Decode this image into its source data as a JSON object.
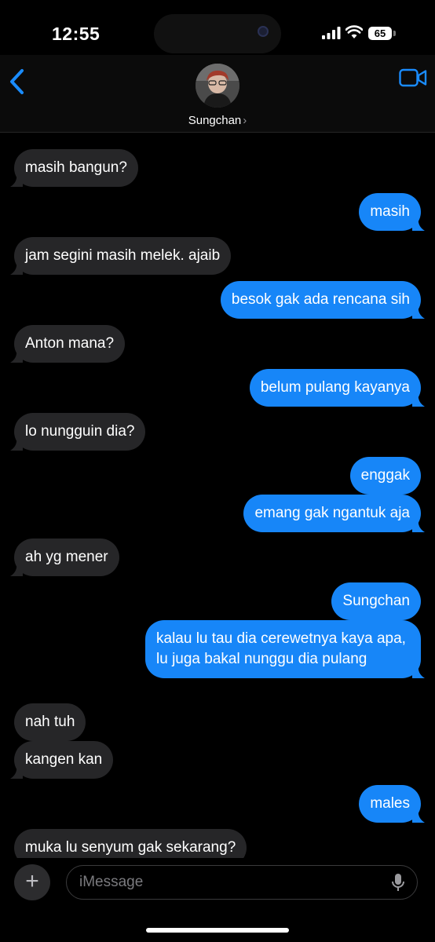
{
  "status": {
    "time": "12:55",
    "battery": "65"
  },
  "header": {
    "contact_name": "Sungchan",
    "chevron": "›"
  },
  "messages": [
    {
      "dir": "in",
      "text": "masih bangun?"
    },
    {
      "dir": "out",
      "text": "masih"
    },
    {
      "dir": "in",
      "text": "jam segini masih melek. ajaib"
    },
    {
      "dir": "out",
      "text": "besok gak ada rencana sih"
    },
    {
      "dir": "in",
      "text": "Anton mana?"
    },
    {
      "dir": "out",
      "text": "belum pulang kayanya"
    },
    {
      "dir": "in",
      "text": "lo nungguin dia?"
    },
    {
      "dir": "out",
      "text": "enggak"
    },
    {
      "dir": "out",
      "text": "emang gak ngantuk aja"
    },
    {
      "dir": "in",
      "text": "ah yg mener"
    },
    {
      "dir": "out",
      "text": "Sungchan"
    },
    {
      "dir": "out",
      "text": "kalau lu tau dia cerewetnya kaya apa, lu juga bakal nunggu dia pulang"
    },
    {
      "dir": "in",
      "text": "nah tuh"
    },
    {
      "dir": "in",
      "text": "kangen kan"
    },
    {
      "dir": "out",
      "text": "males"
    },
    {
      "dir": "in",
      "text": "muka lu senyum gak sekarang?"
    }
  ],
  "input": {
    "placeholder": "iMessage",
    "plus_label": "+"
  },
  "colors": {
    "outgoing": "#1786f8",
    "incoming": "#262628",
    "accent": "#1a8cff"
  },
  "icons": [
    "back-chevron-icon",
    "video-camera-icon",
    "plus-icon",
    "microphone-icon",
    "signal-icon",
    "wifi-icon",
    "battery-icon"
  ]
}
